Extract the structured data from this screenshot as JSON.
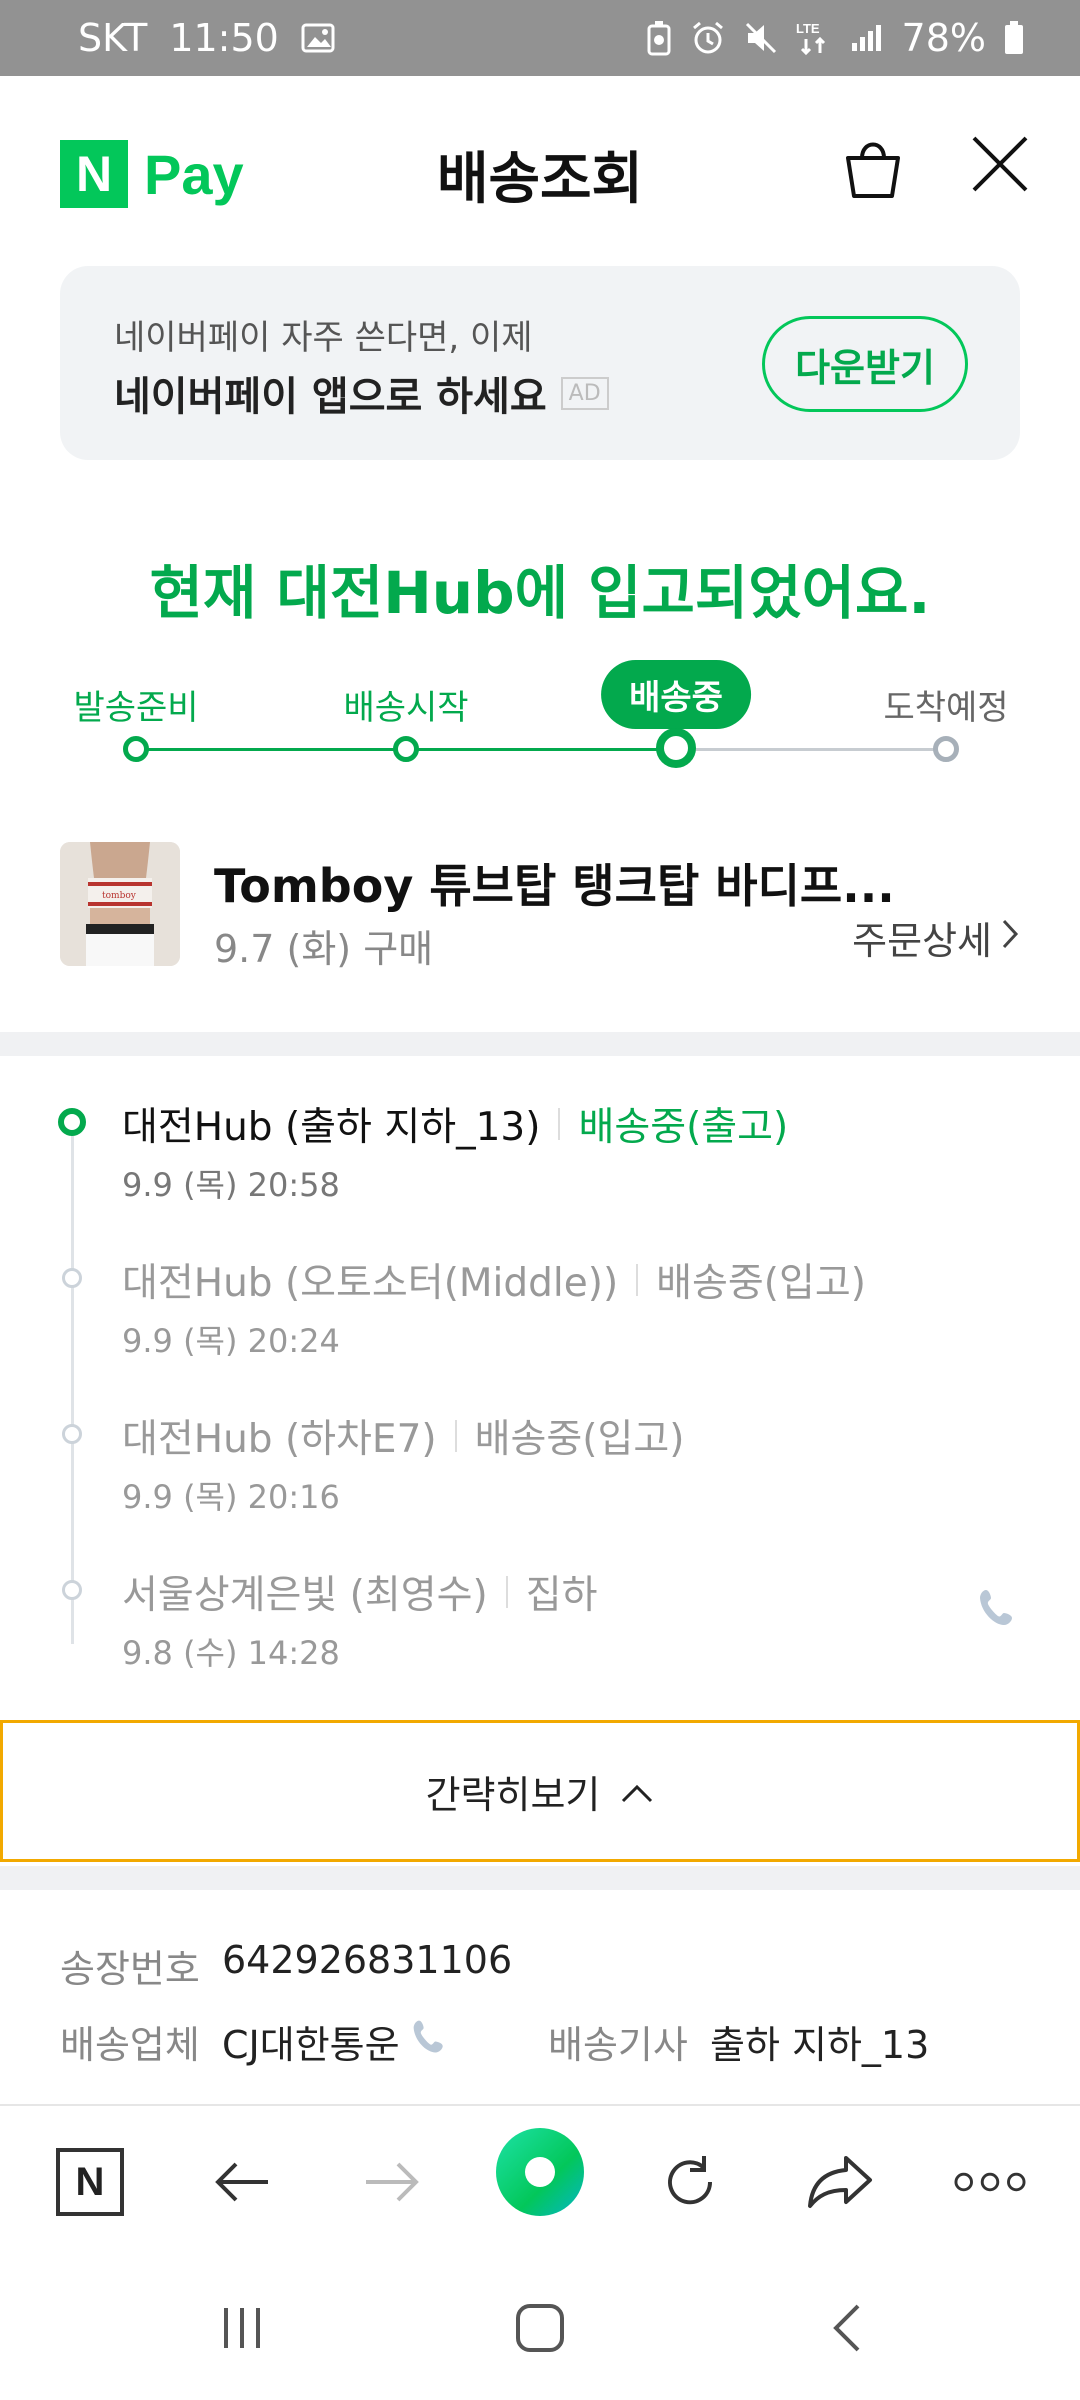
{
  "status_bar": {
    "carrier": "SKT",
    "time": "11:50",
    "battery": "78%",
    "network": "LTE"
  },
  "header": {
    "logo_n": "N",
    "logo_pay": "Pay",
    "title": "배송조회"
  },
  "ad": {
    "subtitle": "네이버페이 자주 쓴다면, 이제",
    "main": "네이버페이 앱으로 하세요",
    "badge": "AD",
    "button": "다운받기"
  },
  "headline": "현재 대전Hub에 입고되었어요.",
  "progress": {
    "steps": [
      {
        "label": "발송준비",
        "state": "done"
      },
      {
        "label": "배송시작",
        "state": "done"
      },
      {
        "label": "배송중",
        "state": "current"
      },
      {
        "label": "도착예정",
        "state": "future"
      }
    ]
  },
  "product": {
    "name": "Tomboy 튜브탑 탱크탑 바디프...",
    "purchase": "9.7 (화) 구매",
    "detail_link": "주문상세"
  },
  "timeline": [
    {
      "location": "대전Hub (출하 지하_13)",
      "status": "배송중(출고)",
      "time": "9.9 (목) 20:58",
      "current": true
    },
    {
      "location": "대전Hub (오토소터(Middle))",
      "status": "배송중(입고)",
      "time": "9.9 (목) 20:24",
      "current": false
    },
    {
      "location": "대전Hub (하차E7)",
      "status": "배송중(입고)",
      "time": "9.9 (목) 20:16",
      "current": false
    },
    {
      "location": "서울상계은빛 (최영수)",
      "status": "집하",
      "time": "9.8 (수) 14:28",
      "current": false
    }
  ],
  "collapse_button": "간략히보기",
  "info": {
    "invoice_label": "송장번호",
    "invoice_value": "642926831106",
    "carrier_label": "배송업체",
    "carrier_value": "CJ대한통운",
    "driver_label": "배송기사",
    "driver_value": "출하 지하_13"
  },
  "toolbar": {
    "home_label": "N"
  },
  "colors": {
    "brand_green": "#03c75a",
    "accent_green": "#03a94d",
    "highlight_border": "#f2a900",
    "status_bar": "#929292"
  }
}
